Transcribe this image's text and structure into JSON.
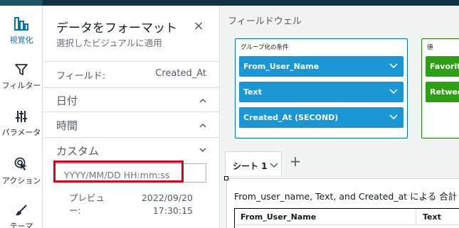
{
  "rail": {
    "items": [
      {
        "label": "視覚化",
        "icon": "bar-chart-icon",
        "active": true
      },
      {
        "label": "フィルター",
        "icon": "filter-icon"
      },
      {
        "label": "パラメータ",
        "icon": "sliders-icon"
      },
      {
        "label": "アクション",
        "icon": "cursor-click-icon"
      },
      {
        "label": "テーマ",
        "icon": "brush-icon"
      }
    ]
  },
  "panel": {
    "title": "データをフォーマット",
    "subtitle": "選択したビジュアルに適用",
    "close_glyph": "×",
    "field_key": "フィールド:",
    "field_value": "Created_At",
    "sections": [
      "日付",
      "時間",
      "カスタム"
    ],
    "format_placeholder": "YYYY/MM/DD HH:mm:ss",
    "format_value": "",
    "preview_label": "プレビュー:",
    "preview_value_date": "2022/09/20",
    "preview_value_time": "17:30:15"
  },
  "wells": {
    "title": "フィールドウェル",
    "group_label": "グループ化の条件",
    "group_fields": [
      "From_User_Name",
      "Text",
      "Created_At (SECOND)"
    ],
    "value_label": "値",
    "value_fields": [
      "Favorite",
      "Retweet"
    ]
  },
  "sheet": {
    "tab_label": "シート 1",
    "add_glyph": "+",
    "visual_title": "From_user_name, Text, and Created_at による 合計 of",
    "columns": [
      "From_User_Name",
      "Text"
    ]
  },
  "colors": {
    "accent": "#0073bb",
    "pill_blue": "#1b96d4",
    "pill_green": "#2ea013",
    "highlight_red": "#e0001b"
  }
}
